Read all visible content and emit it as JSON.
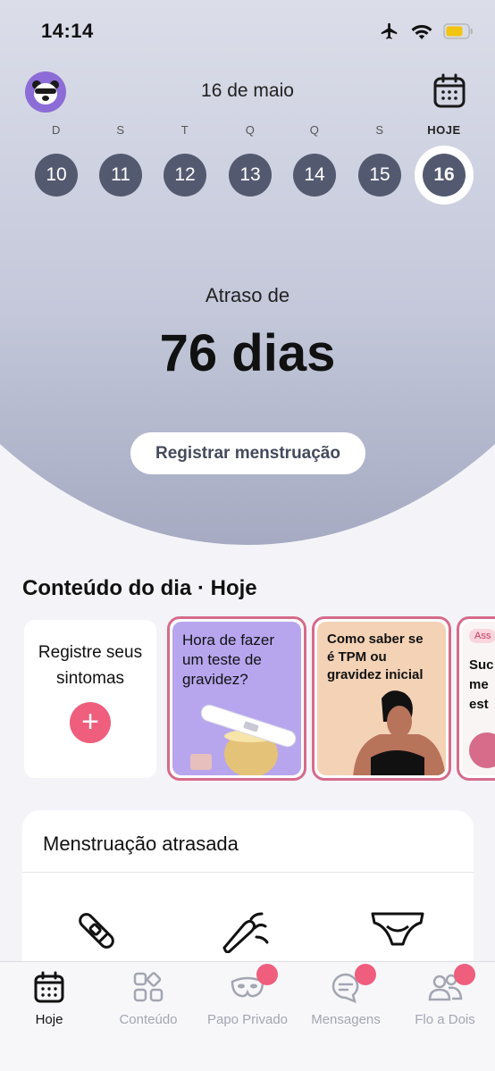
{
  "status": {
    "time": "14:14"
  },
  "header": {
    "date": "16 de maio"
  },
  "days": [
    {
      "letter": "D",
      "number": "10"
    },
    {
      "letter": "S",
      "number": "11"
    },
    {
      "letter": "T",
      "number": "12"
    },
    {
      "letter": "Q",
      "number": "13"
    },
    {
      "letter": "Q",
      "number": "14"
    },
    {
      "letter": "S",
      "number": "15"
    },
    {
      "letter": "HOJE",
      "number": "16"
    }
  ],
  "cycle": {
    "label": "Atraso de",
    "value": "76 dias",
    "register_button": "Registrar menstruação"
  },
  "content": {
    "title": "Conteúdo do dia · Hoje",
    "symptoms_card": {
      "label": "Registre seus sintomas"
    },
    "stories": [
      {
        "text": "Hora de fazer um teste de gravidez?",
        "bg": "#b7a6ee"
      },
      {
        "text": "Como saber se é TPM ou gravidez inicial",
        "bg": "#f3d2b6"
      },
      {
        "tag": "Ass",
        "text": "Suc me est",
        "bg": "#f8f5f4"
      }
    ]
  },
  "panel": {
    "title": "Menstruação atrasada",
    "icons": [
      "pregnancy-test-icon",
      "vibrator-icon",
      "underwear-icon"
    ]
  },
  "tabs": [
    {
      "label": "Hoje",
      "icon": "calendar-icon",
      "active": true,
      "badge": false
    },
    {
      "label": "Conteúdo",
      "icon": "grid-icon",
      "active": false,
      "badge": false
    },
    {
      "label": "Papo Privado",
      "icon": "mask-icon",
      "active": false,
      "badge": true
    },
    {
      "label": "Mensagens",
      "icon": "chat-icon",
      "active": false,
      "badge": true
    },
    {
      "label": "Flo a Dois",
      "icon": "partner-icon",
      "active": false,
      "badge": true
    }
  ],
  "colors": {
    "accent": "#ef5e7d",
    "day_circle": "#535a70",
    "story_border": "#d66b8a",
    "avatar": "#8c6cd6"
  }
}
